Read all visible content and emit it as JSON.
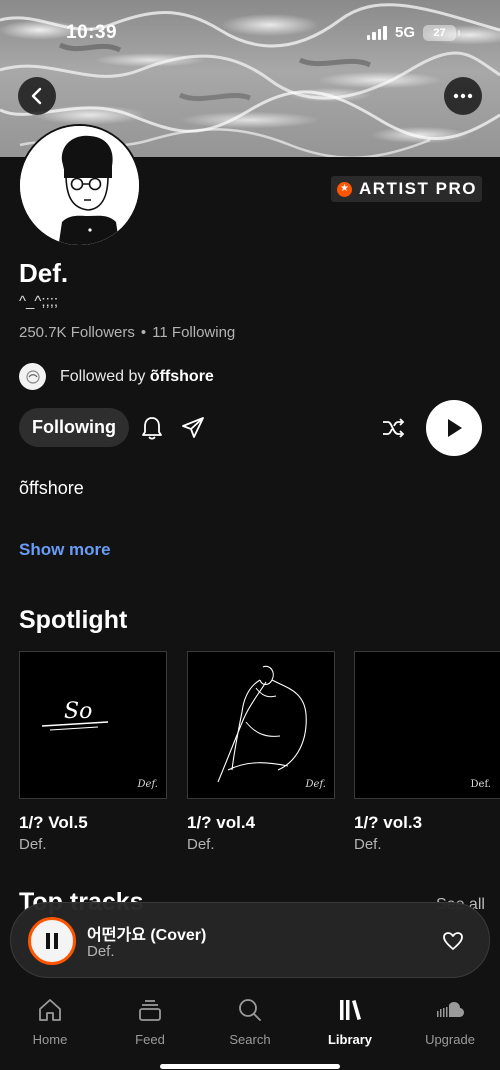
{
  "status_bar": {
    "time": "10:39",
    "network": "5G",
    "battery": "27"
  },
  "header": {
    "back_icon": "chevron-left-icon",
    "more_icon": "ellipsis-icon"
  },
  "artist": {
    "badge": "ARTIST PRO",
    "name": "Def.",
    "subtitle": "^_^;;;;",
    "followers": "250.7K Followers",
    "following": "11 Following",
    "followed_by_prefix": "Followed by",
    "followed_by_name": "õffshore",
    "bio": "õffshore",
    "show_more": "Show more"
  },
  "actions": {
    "following_label": "Following",
    "icons": [
      "bell-icon",
      "share-icon",
      "shuffle-icon",
      "play-icon"
    ]
  },
  "spotlight": {
    "title": "Spotlight",
    "items": [
      {
        "title": "1/? Vol.5",
        "artist": "Def.",
        "art_text": "So",
        "mark": "Def."
      },
      {
        "title": "1/? vol.4",
        "artist": "Def.",
        "mark": "Def."
      },
      {
        "title": "1/? vol.3",
        "artist": "Def.",
        "mark": "Def."
      }
    ]
  },
  "top_tracks": {
    "title": "Top tracks",
    "see_all": "See all"
  },
  "now_playing": {
    "title": "어떤가요 (Cover)",
    "artist": "Def.",
    "state": "playing"
  },
  "tabs": [
    {
      "label": "Home",
      "icon": "home-icon",
      "active": false
    },
    {
      "label": "Feed",
      "icon": "feed-icon",
      "active": false
    },
    {
      "label": "Search",
      "icon": "search-icon",
      "active": false
    },
    {
      "label": "Library",
      "icon": "library-icon",
      "active": true
    },
    {
      "label": "Upgrade",
      "icon": "soundcloud-icon",
      "active": false
    }
  ],
  "colors": {
    "accent": "#ff5500",
    "link": "#6a9cf5",
    "background": "#121212"
  }
}
